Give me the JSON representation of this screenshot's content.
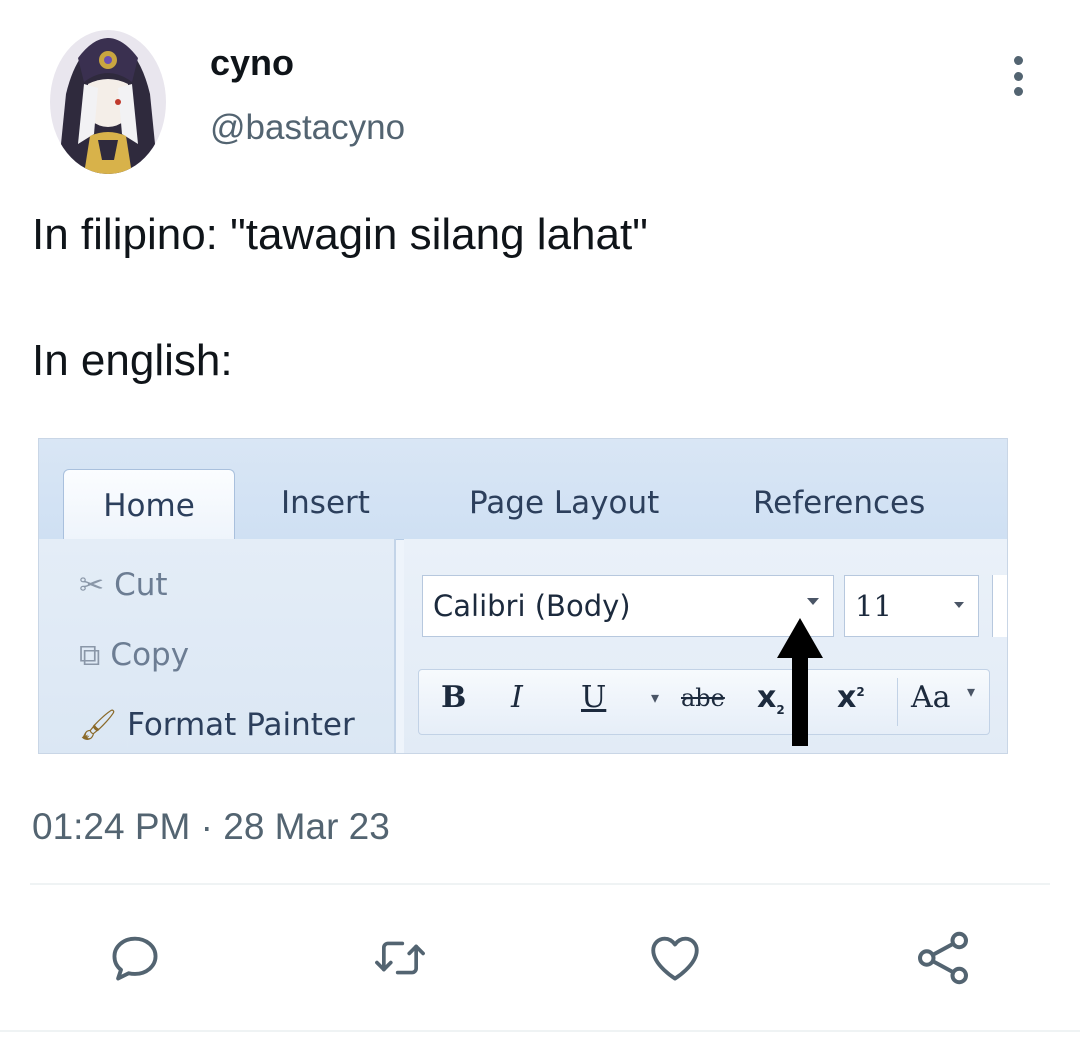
{
  "user": {
    "display_name": "cyno",
    "handle": "@bastacyno"
  },
  "tweet": {
    "line1": "In filipino: \"tawagin silang lahat\"",
    "line2": "In english:"
  },
  "ribbon": {
    "tabs": [
      "Home",
      "Insert",
      "Page Layout",
      "References"
    ],
    "clipboard": {
      "cut": "Cut",
      "copy": "Copy",
      "format_painter": "Format Painter"
    },
    "font_name": "Calibri (Body)",
    "font_size": "11",
    "format_buttons": {
      "bold": "B",
      "italic": "I",
      "underline": "U",
      "strike": "abe",
      "subscript": "x",
      "superscript": "x",
      "change_case": "Aa"
    }
  },
  "meta": {
    "timestamp": "01:24 PM · 28 Mar 23"
  },
  "actions": {
    "reply_icon": "speech-bubble",
    "retweet_icon": "retweet-arrows",
    "like_icon": "heart",
    "share_icon": "share-nodes"
  },
  "colors": {
    "text": "#0f1419",
    "secondary": "#536471",
    "ribbon_bg": "#eef4fb"
  }
}
